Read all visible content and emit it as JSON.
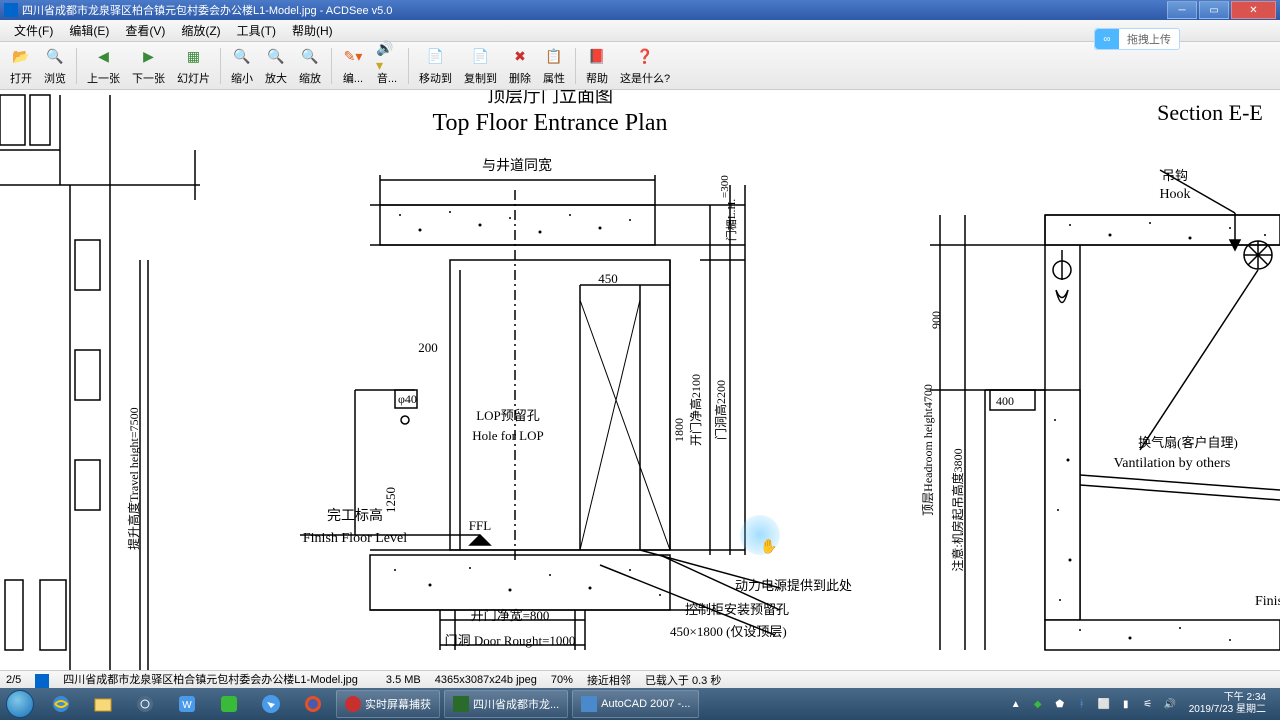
{
  "app": {
    "name": "ACDSee v5.0",
    "title": "四川省成都市龙泉驿区柏合镇元包村委会办公楼L1-Model.jpg - ACDSee v5.0"
  },
  "menu": {
    "file": "文件(F)",
    "edit": "编辑(E)",
    "view": "查看(V)",
    "zoom": "缩放(Z)",
    "tools": "工具(T)",
    "help": "帮助(H)"
  },
  "upload": {
    "label": "拖拽上传"
  },
  "toolbar": {
    "open": "打开",
    "browse": "浏览",
    "prev": "上一张",
    "next": "下一张",
    "slide": "幻灯片",
    "zoomout": "缩小",
    "zoomin": "放大",
    "zoomsel": "缩放",
    "edit": "编...",
    "audio": "音...",
    "moveto": "移动到",
    "copyto": "复制到",
    "delete": "删除",
    "props": "属性",
    "helpbtn": "帮助",
    "whatis": "这是什么?"
  },
  "drawing": {
    "title_en": "Top Floor Entrance Plan",
    "title_cn": "顶层厅门立面图",
    "section": "Section E-E",
    "shaft_width": "与井道同宽",
    "hook_cn": "吊钩",
    "hook_en": "Hook",
    "lop_cn": "LOP预留孔",
    "lop_en": "Hole for LOP",
    "ffl": "FFL",
    "finish_cn": "完工标高",
    "finish_en": "Finish Floor Level",
    "vent_cn": "换气扇(客户自理)",
    "vent_en": "Vantilation by others",
    "power": "动力电源提供到此处",
    "ctrl": "控制柜安装预留孔",
    "reserve": "450×1800 (仅设顶层)",
    "door_clear": "开门净宽=800",
    "door_rough": "门洞 Door Rought=1000",
    "d200": "200",
    "d450": "450",
    "d1250": "1250",
    "d1800": "1800",
    "d2100": "2100",
    "d2200": "2200",
    "d300": "=300",
    "d400": "400",
    "d900": "900",
    "d4700": "4700",
    "d3800": "3800",
    "d7500": "7500",
    "phi40": "φ40",
    "travel": "提升高度Travel height=7500",
    "headroom": "顶层Headroom height4700",
    "machinepit": "注意:机房起吊高度3800",
    "lintel": "门楣L.H.",
    "door_clear_h": "开门净高2100",
    "door_rough_h": "门洞高2200",
    "finish_r": "Finish"
  },
  "status": {
    "page": "2/5",
    "file": "四川省成都市龙泉驿区柏合镇元包村委会办公楼L1-Model.jpg",
    "size": "3.5 MB",
    "dims": "4365x3087x24b jpeg",
    "zoom": "70%",
    "proximity": "接近相邻",
    "loaded": "已载入于 0.3 秒"
  },
  "taskbar": {
    "screencap": "实时屏幕捕获",
    "acdsee": "四川省成都市龙...",
    "autocad": "AutoCAD 2007 -..."
  },
  "clock": {
    "time": "下午 2:34",
    "date": "2019/7/23 星期二"
  }
}
